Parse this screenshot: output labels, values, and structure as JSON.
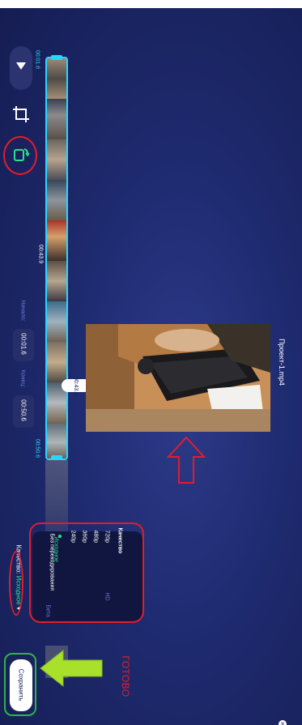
{
  "file_name": "Проект-1.mp4",
  "toolbar": {
    "dropdown_icon": "triangle-down-icon",
    "crop_icon": "crop-icon",
    "rotate_icon": "rotate-icon"
  },
  "timeline": {
    "start_marker": "00:01.6",
    "middle_marker": "00:43.9",
    "end_marker": "00:50.6",
    "playhead": "00:43.6"
  },
  "trim": {
    "start_label": "Начало:",
    "start_value": "00:01.6",
    "end_label": "Конец:",
    "end_value": "00:50.6"
  },
  "quality_menu": {
    "title": "Качество",
    "options": [
      {
        "label": "720p",
        "badge": "HD"
      },
      {
        "label": "480p",
        "badge": ""
      },
      {
        "label": "360p",
        "badge": ""
      },
      {
        "label": "240p",
        "badge": ""
      },
      {
        "label": "Исходное",
        "badge": "",
        "selected": true
      },
      {
        "label": "Без перекодирования",
        "badge": "Бета"
      }
    ]
  },
  "quality_selector": {
    "prefix": "Качество:",
    "value": "Исходное"
  },
  "save_button": "Сохранить",
  "annotation_text": "ГОТОВО",
  "close_icon": "close-icon",
  "colors": {
    "accent_cyan": "#27d6ff",
    "accent_green": "#2ee08a",
    "annotation_red": "#e21d2b",
    "annotation_green": "#2fb24a",
    "background": "#1e2a6e"
  }
}
